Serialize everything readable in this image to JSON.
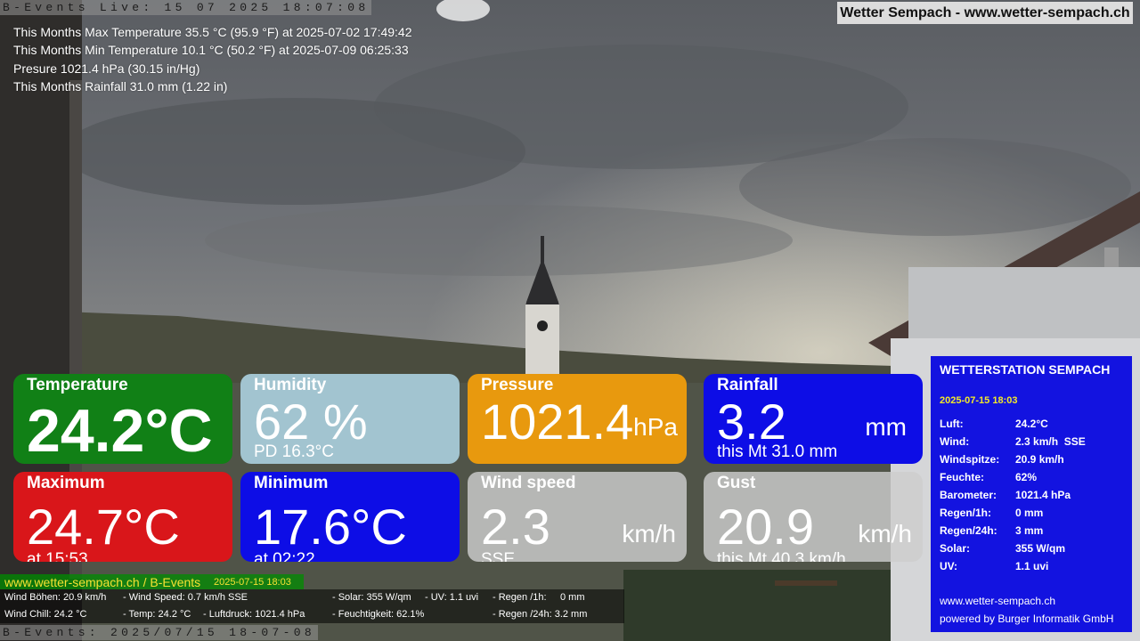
{
  "header": {
    "live_stamp": "B-Events Live: 15 07 2025 18:07:08",
    "brand": "Wetter Sempach - www.wetter-sempach.ch"
  },
  "stats": [
    "This Months Max Temperature 35.5 °C (95.9 °F) at 2025-07-02 17:49:42",
    "This Months Min Temperature 10.1 °C (50.2 °F) at 2025-07-09 06:25:33",
    "Presure 1021.4 hPa (30.15 in/Hg)",
    "This Months Rainfall 31.0 mm (1.22 in)"
  ],
  "cards": {
    "temperature": {
      "label": "Temperature",
      "value": "24.2°C",
      "color": "#118016"
    },
    "humidity": {
      "label": "Humidity",
      "value": "62 %",
      "sub": "PD 16.3°C",
      "color": "#a9cedc"
    },
    "pressure": {
      "label": "Pressure",
      "value": "1021.4",
      "unit": "hPa",
      "color": "#e8990e"
    },
    "rainfall": {
      "label": "Rainfall",
      "value": "3.2",
      "unit": "mm",
      "sub": "this Mt 31.0 mm",
      "color": "#0d0de6"
    },
    "maximum": {
      "label": "Maximum",
      "value": "24.7°C",
      "sub": "at 15:53",
      "color": "#d9161a"
    },
    "minimum": {
      "label": "Minimum",
      "value": "17.6°C",
      "sub": "at 02:22",
      "color": "#0d0de6"
    },
    "windspeed": {
      "label": "Wind speed",
      "value": "2.3",
      "unit": "km/h",
      "sub": "SSE",
      "color": "#cdcdcd"
    },
    "gust": {
      "label": "Gust",
      "value": "20.9",
      "unit": "km/h",
      "sub": "this Mt 40.3 km/h",
      "color": "#cdcdcd"
    }
  },
  "panel": {
    "title": "WETTERSTATION SEMPACH",
    "date": "2025-07-15 18:03",
    "rows": [
      {
        "key": "Luft:",
        "value": "24.2°C"
      },
      {
        "key": "Wind:",
        "value": "2.3 km/h  SSE"
      },
      {
        "key": "Windspitze:",
        "value": "20.9 km/h"
      },
      {
        "key": "Feuchte:",
        "value": "62%"
      },
      {
        "key": "Barometer:",
        "value": "1021.4 hPa"
      },
      {
        "key": "Regen/1h:",
        "value": "0 mm"
      },
      {
        "key": "Regen/24h:",
        "value": "3 mm"
      },
      {
        "key": "Solar:",
        "value": "355 W/qm"
      },
      {
        "key": "UV:",
        "value": "1.1 uvi"
      }
    ],
    "footer1": "www.wetter-sempach.ch",
    "footer2": "powered by Burger Informatik GmbH",
    "color": "#1313e0"
  },
  "ticker": {
    "site": "www.wetter-sempach.ch / B-Events",
    "date": "2025-07-15 18:03"
  },
  "strip": {
    "l1a": "Wind Böhen: 20.9 km/h",
    "l1b": "- Wind Speed: 0.7 km/h SSE",
    "l1c": "- Solar: 355 W/qm",
    "l1d": "- UV: 1.1 uvi",
    "l1e": "- Regen /1h:",
    "l1f": "0 mm",
    "l2a": "Wind Chill: 24.2 °C",
    "l2b": "- Temp: 24.2 °C",
    "l2c": "- Luftdruck: 1021.4 hPa",
    "l2d": "- Feuchtigkeit: 62.1%",
    "l2e": "- Regen /24h: 3.2 mm"
  },
  "footer_stamp": "B-Events: 2025/07/15 18-07-08"
}
